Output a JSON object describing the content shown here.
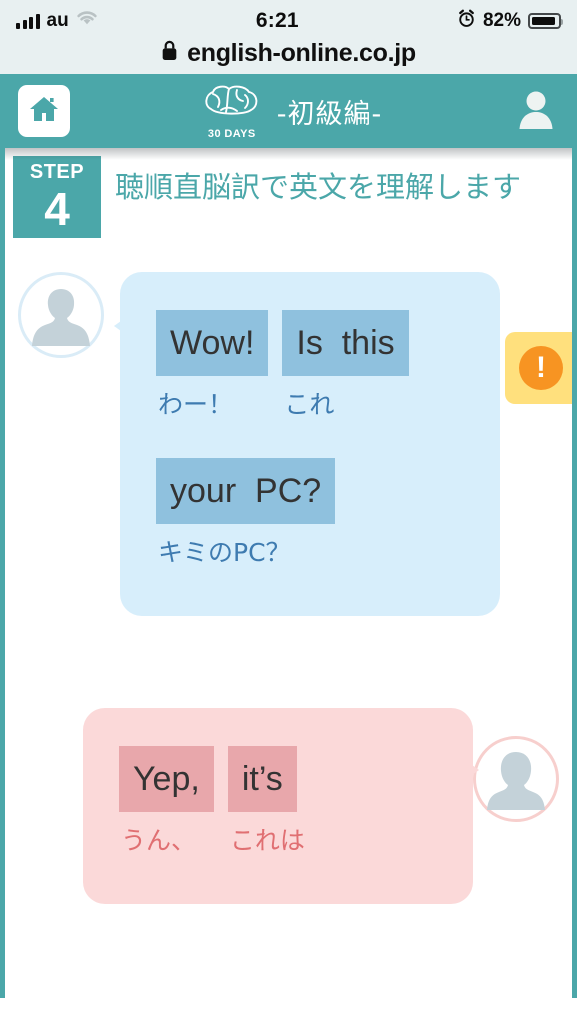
{
  "statusbar": {
    "carrier": "au",
    "time": "6:21",
    "battery_percent": "82%",
    "signal_icon": "signal-bars-icon",
    "wifi_icon": "wifi-icon",
    "alarm_icon": "alarm-clock-icon",
    "battery_icon": "battery-icon"
  },
  "browser": {
    "lock_icon": "lock-icon",
    "url": "english-online.co.jp"
  },
  "appbar": {
    "home_icon": "home-icon",
    "brand_icon": "brain-icon",
    "brand_text": "30 DAYS",
    "title": "-初級編-",
    "account_icon": "user-avatar-icon",
    "accent_color": "#4ba7a9"
  },
  "step": {
    "label": "STEP",
    "number": "4",
    "title": "聴順直脳訳で英文を理解します"
  },
  "warning": {
    "icon": "exclamation-icon",
    "glyph": "!",
    "bg_color": "#ffe07d",
    "icon_color": "#f79422"
  },
  "messages": [
    {
      "speaker": "left",
      "avatar_icon": "person-silhouette-icon",
      "bubble_color": "#d7eefb",
      "chip_color": "#8fc1de",
      "lines": [
        [
          {
            "en": "Wow!",
            "ja": "わー！"
          },
          {
            "en": "Is  this",
            "ja": "これ"
          }
        ],
        [
          {
            "en": "your  PC?",
            "ja": "キミのPC？"
          }
        ]
      ]
    },
    {
      "speaker": "right",
      "avatar_icon": "person-silhouette-icon",
      "bubble_color": "#fbd9d9",
      "chip_color": "#e8a7ab",
      "lines": [
        [
          {
            "en": "Yep,",
            "ja": "うん、"
          },
          {
            "en": "it’s",
            "ja": "これは"
          }
        ]
      ]
    }
  ]
}
